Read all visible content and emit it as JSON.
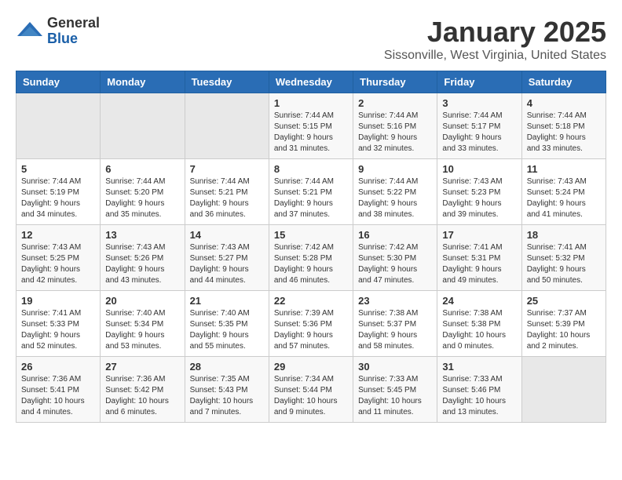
{
  "header": {
    "logo_general": "General",
    "logo_blue": "Blue",
    "title": "January 2025",
    "subtitle": "Sissonville, West Virginia, United States"
  },
  "weekdays": [
    "Sunday",
    "Monday",
    "Tuesday",
    "Wednesday",
    "Thursday",
    "Friday",
    "Saturday"
  ],
  "weeks": [
    [
      {
        "day": "",
        "info": ""
      },
      {
        "day": "",
        "info": ""
      },
      {
        "day": "",
        "info": ""
      },
      {
        "day": "1",
        "info": "Sunrise: 7:44 AM\nSunset: 5:15 PM\nDaylight: 9 hours and 31 minutes."
      },
      {
        "day": "2",
        "info": "Sunrise: 7:44 AM\nSunset: 5:16 PM\nDaylight: 9 hours and 32 minutes."
      },
      {
        "day": "3",
        "info": "Sunrise: 7:44 AM\nSunset: 5:17 PM\nDaylight: 9 hours and 33 minutes."
      },
      {
        "day": "4",
        "info": "Sunrise: 7:44 AM\nSunset: 5:18 PM\nDaylight: 9 hours and 33 minutes."
      }
    ],
    [
      {
        "day": "5",
        "info": "Sunrise: 7:44 AM\nSunset: 5:19 PM\nDaylight: 9 hours and 34 minutes."
      },
      {
        "day": "6",
        "info": "Sunrise: 7:44 AM\nSunset: 5:20 PM\nDaylight: 9 hours and 35 minutes."
      },
      {
        "day": "7",
        "info": "Sunrise: 7:44 AM\nSunset: 5:21 PM\nDaylight: 9 hours and 36 minutes."
      },
      {
        "day": "8",
        "info": "Sunrise: 7:44 AM\nSunset: 5:21 PM\nDaylight: 9 hours and 37 minutes."
      },
      {
        "day": "9",
        "info": "Sunrise: 7:44 AM\nSunset: 5:22 PM\nDaylight: 9 hours and 38 minutes."
      },
      {
        "day": "10",
        "info": "Sunrise: 7:43 AM\nSunset: 5:23 PM\nDaylight: 9 hours and 39 minutes."
      },
      {
        "day": "11",
        "info": "Sunrise: 7:43 AM\nSunset: 5:24 PM\nDaylight: 9 hours and 41 minutes."
      }
    ],
    [
      {
        "day": "12",
        "info": "Sunrise: 7:43 AM\nSunset: 5:25 PM\nDaylight: 9 hours and 42 minutes."
      },
      {
        "day": "13",
        "info": "Sunrise: 7:43 AM\nSunset: 5:26 PM\nDaylight: 9 hours and 43 minutes."
      },
      {
        "day": "14",
        "info": "Sunrise: 7:43 AM\nSunset: 5:27 PM\nDaylight: 9 hours and 44 minutes."
      },
      {
        "day": "15",
        "info": "Sunrise: 7:42 AM\nSunset: 5:28 PM\nDaylight: 9 hours and 46 minutes."
      },
      {
        "day": "16",
        "info": "Sunrise: 7:42 AM\nSunset: 5:30 PM\nDaylight: 9 hours and 47 minutes."
      },
      {
        "day": "17",
        "info": "Sunrise: 7:41 AM\nSunset: 5:31 PM\nDaylight: 9 hours and 49 minutes."
      },
      {
        "day": "18",
        "info": "Sunrise: 7:41 AM\nSunset: 5:32 PM\nDaylight: 9 hours and 50 minutes."
      }
    ],
    [
      {
        "day": "19",
        "info": "Sunrise: 7:41 AM\nSunset: 5:33 PM\nDaylight: 9 hours and 52 minutes."
      },
      {
        "day": "20",
        "info": "Sunrise: 7:40 AM\nSunset: 5:34 PM\nDaylight: 9 hours and 53 minutes."
      },
      {
        "day": "21",
        "info": "Sunrise: 7:40 AM\nSunset: 5:35 PM\nDaylight: 9 hours and 55 minutes."
      },
      {
        "day": "22",
        "info": "Sunrise: 7:39 AM\nSunset: 5:36 PM\nDaylight: 9 hours and 57 minutes."
      },
      {
        "day": "23",
        "info": "Sunrise: 7:38 AM\nSunset: 5:37 PM\nDaylight: 9 hours and 58 minutes."
      },
      {
        "day": "24",
        "info": "Sunrise: 7:38 AM\nSunset: 5:38 PM\nDaylight: 10 hours and 0 minutes."
      },
      {
        "day": "25",
        "info": "Sunrise: 7:37 AM\nSunset: 5:39 PM\nDaylight: 10 hours and 2 minutes."
      }
    ],
    [
      {
        "day": "26",
        "info": "Sunrise: 7:36 AM\nSunset: 5:41 PM\nDaylight: 10 hours and 4 minutes."
      },
      {
        "day": "27",
        "info": "Sunrise: 7:36 AM\nSunset: 5:42 PM\nDaylight: 10 hours and 6 minutes."
      },
      {
        "day": "28",
        "info": "Sunrise: 7:35 AM\nSunset: 5:43 PM\nDaylight: 10 hours and 7 minutes."
      },
      {
        "day": "29",
        "info": "Sunrise: 7:34 AM\nSunset: 5:44 PM\nDaylight: 10 hours and 9 minutes."
      },
      {
        "day": "30",
        "info": "Sunrise: 7:33 AM\nSunset: 5:45 PM\nDaylight: 10 hours and 11 minutes."
      },
      {
        "day": "31",
        "info": "Sunrise: 7:33 AM\nSunset: 5:46 PM\nDaylight: 10 hours and 13 minutes."
      },
      {
        "day": "",
        "info": ""
      }
    ]
  ]
}
